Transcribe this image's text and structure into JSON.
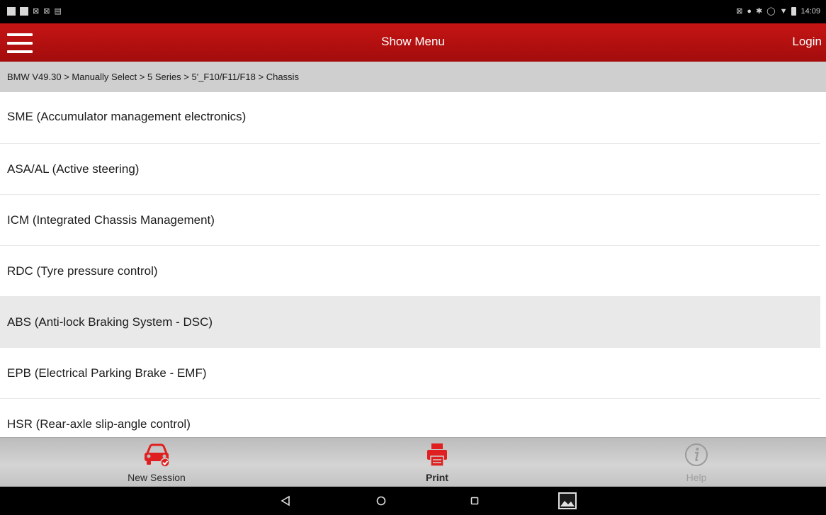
{
  "status_bar": {
    "left_icons": [
      "notification-icon",
      "photo-icon",
      "sim-icon",
      "sim-icon",
      "keyboard-icon"
    ],
    "right_icons": [
      "mute-icon",
      "location-icon",
      "bluetooth-icon",
      "sync-icon",
      "wifi-icon",
      "battery-icon"
    ],
    "time": "14:09"
  },
  "header": {
    "menu_icon": "hamburger-menu-icon",
    "title": "Show Menu",
    "login_label": "Login",
    "accent_color": "#b80f0f"
  },
  "breadcrumb": {
    "text": "BMW V49.30 > Manually Select > 5 Series > 5'_F10/F11/F18 > Chassis"
  },
  "list": {
    "items": [
      {
        "label": "SME (Accumulator management electronics)"
      },
      {
        "label": "ASA/AL (Active steering)"
      },
      {
        "label": "ICM (Integrated Chassis Management)"
      },
      {
        "label": "RDC (Tyre pressure control)"
      },
      {
        "label": "ABS (Anti-lock Braking System - DSC)",
        "selected": true
      },
      {
        "label": "EPB (Electrical Parking Brake - EMF)"
      },
      {
        "label": "HSR (Rear-axle slip-angle control)"
      }
    ]
  },
  "toolbar": {
    "new_session_label": "New Session",
    "new_session_icon": "car-check-icon",
    "print_label": "Print",
    "print_icon": "printer-icon",
    "help_label": "Help",
    "help_icon": "info-icon",
    "icon_color": "#e02020"
  },
  "nav_bar": {
    "icons": [
      "back-icon",
      "home-icon",
      "recent-apps-icon",
      "screenshot-icon"
    ]
  }
}
